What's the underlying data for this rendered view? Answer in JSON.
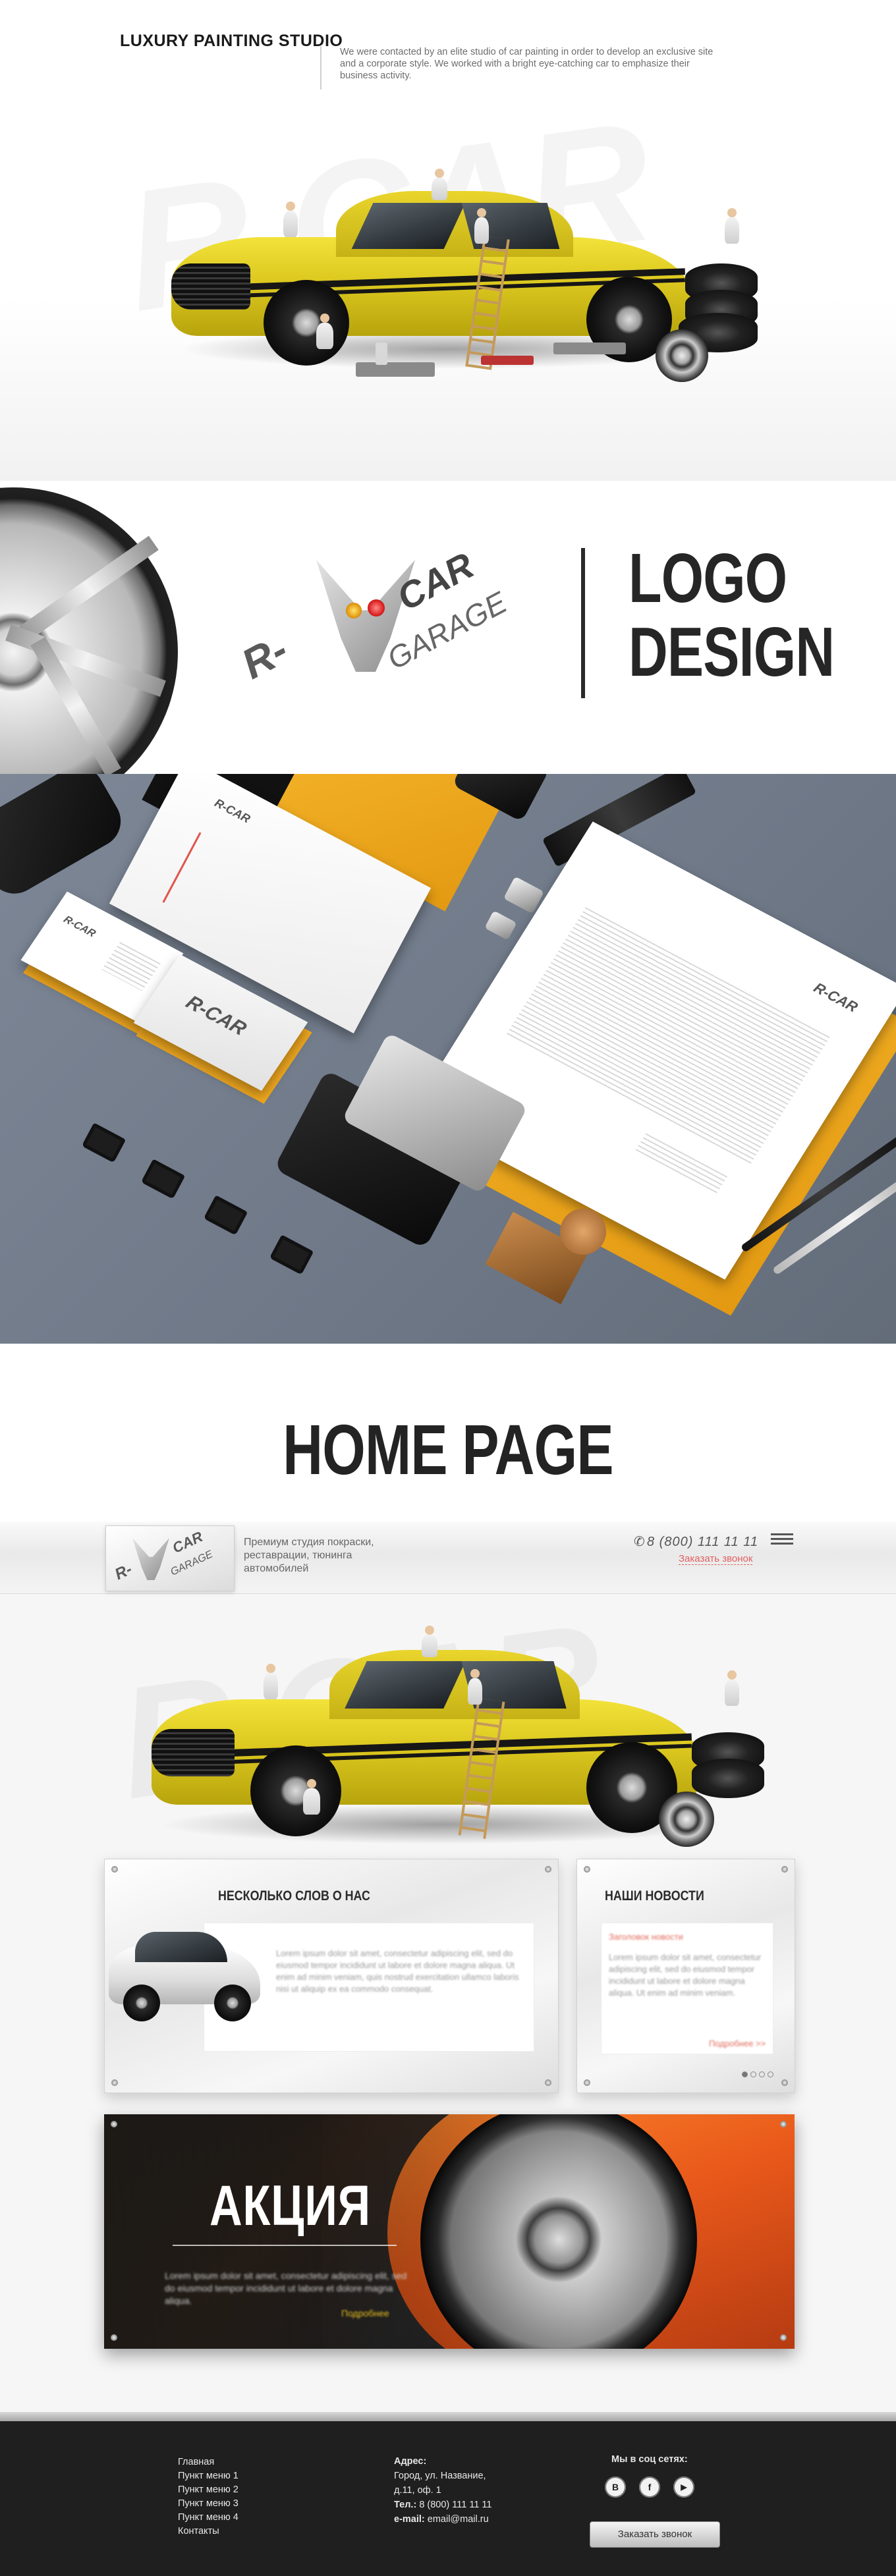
{
  "intro": {
    "title": "LUXURY PAINTING STUDIO",
    "description": "We were contacted by an elite studio of car painting in order to develop an exclusive site and a corporate style. We worked with a bright eye-catching car to emphasize their business activity."
  },
  "logo_section": {
    "heading_line1": "LOGO",
    "heading_line2": "DESIGN",
    "logo_text_r": "R-",
    "logo_text_car": "CAR",
    "logo_text_garage": "GARAGE"
  },
  "home_heading": {
    "title": "HOME PAGE"
  },
  "mockup": {
    "header": {
      "tagline": "Премиум студия покраски, реставрации, тюнинга автомобилей",
      "phone": "8 (800) 111 11 11",
      "callback_link": "Заказать звонок"
    },
    "about": {
      "title": "НЕСКОЛЬКО СЛОВ О НАС",
      "text": "Lorem ipsum dolor sit amet, consectetur adipiscing elit, sed do eiusmod tempor incididunt ut labore et dolore magna aliqua. Ut enim ad minim veniam, quis nostrud exercitation ullamco laboris nisi ut aliquip ex ea commodo consequat."
    },
    "news": {
      "title": "НАШИ НОВОСТИ",
      "headline": "Заголовок новости",
      "text": "Lorem ipsum dolor sit amet, consectetur adipiscing elit, sed do eiusmod tempor incididunt ut labore et dolore magna aliqua. Ut enim ad minim veniam.",
      "more": "Подробнее >>"
    },
    "promo": {
      "title": "АКЦИЯ",
      "text": "Lorem ipsum dolor sit amet, consectetur adipiscing elit, sed do eiusmod tempor incididunt ut labore et dolore magna aliqua.",
      "more": "Подробнее"
    }
  },
  "footer": {
    "menu": [
      "Главная",
      "Пункт меню 1",
      "Пункт меню 2",
      "Пункт меню 3",
      "Пункт меню 4",
      "Контакты"
    ],
    "address_label": "Адрес:",
    "address_line1": "Город, ул. Название,",
    "address_line2": "д.11, оф. 1",
    "phone_label": "Тел.:",
    "phone_value": "8 (800) 111 11 11",
    "email_label": "e-mail:",
    "email_value": "email@mail.ru",
    "social_title": "Мы в соц сетях:",
    "social": [
      {
        "icon": "vk-icon",
        "glyph": "В"
      },
      {
        "icon": "facebook-icon",
        "glyph": "f"
      },
      {
        "icon": "youtube-icon",
        "glyph": "▶"
      }
    ],
    "callback_button": "Заказать звонок"
  },
  "colors": {
    "car_yellow": "#e0cc22",
    "promo_orange": "#e8581a",
    "folder_orange": "#f0a81f",
    "link_red": "#e26060",
    "footer_bg": "#1f1f1f",
    "stationery_bg": "#737d8c"
  }
}
